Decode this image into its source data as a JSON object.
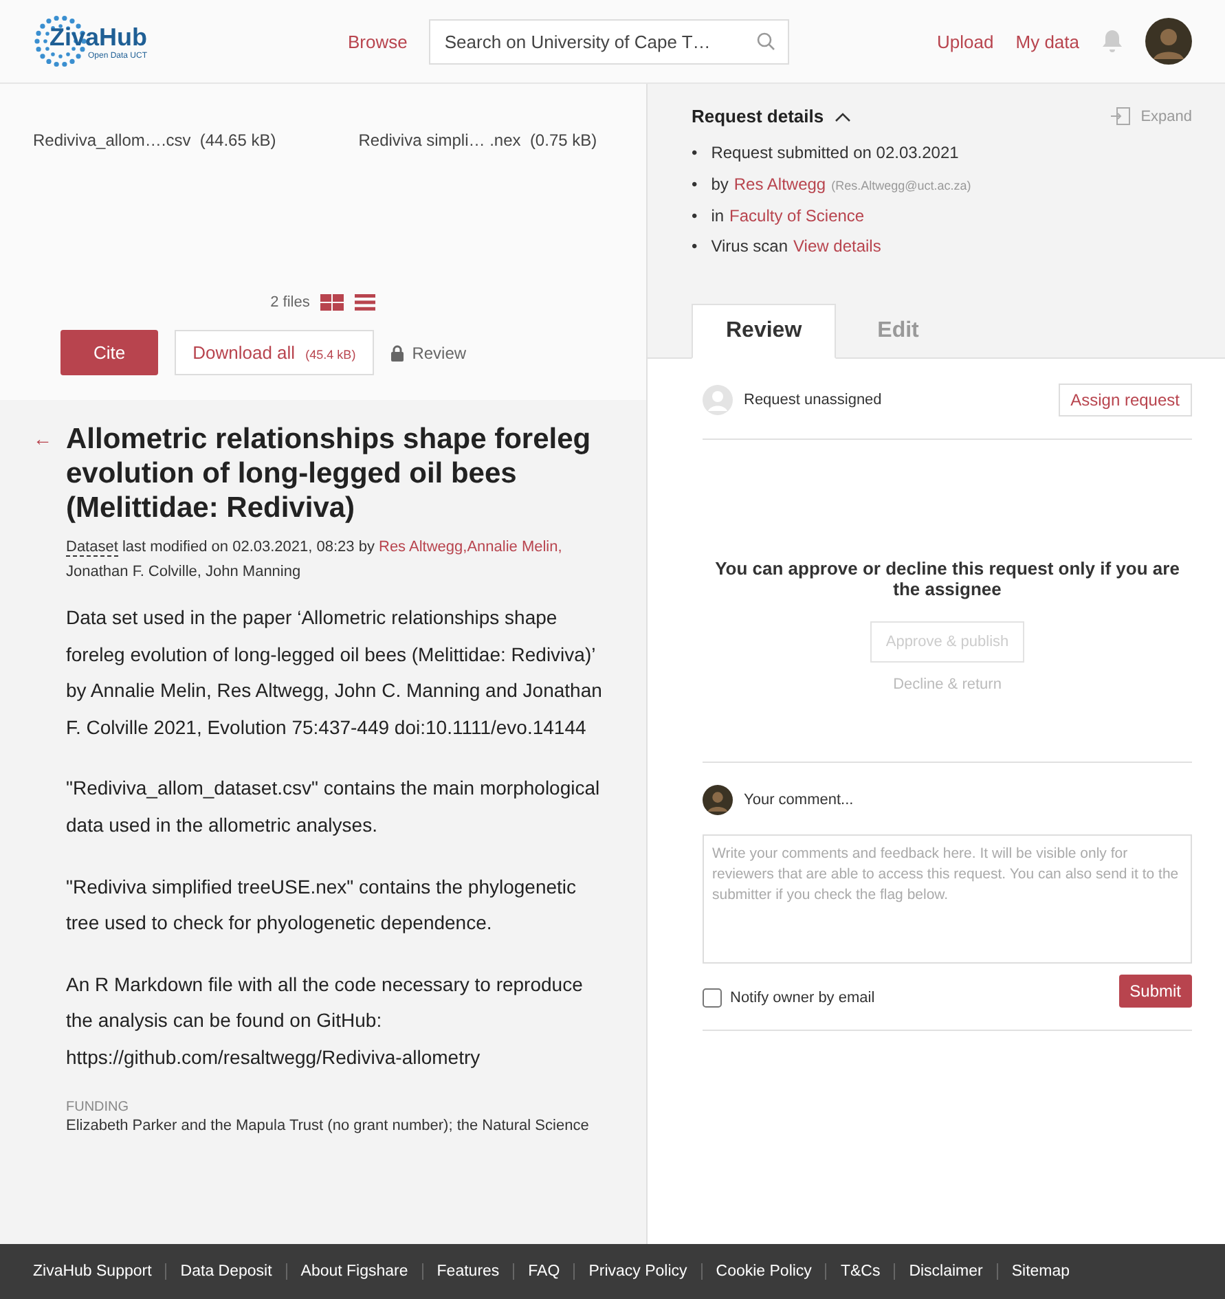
{
  "header": {
    "logo": {
      "name": "ZivaHub",
      "tagline": "Open Data UCT"
    },
    "nav": [
      {
        "label": "Browse"
      }
    ],
    "search": {
      "placeholder": "Search on University of Cape T…"
    },
    "actions": [
      {
        "label": "Upload"
      },
      {
        "label": "My data"
      }
    ]
  },
  "files": {
    "items": [
      {
        "name": "Rediviva_allom….csv",
        "size": "(44.65 kB)"
      },
      {
        "name": "Rediviva simpli… .nex",
        "size": "(0.75 kB)"
      }
    ],
    "count": "2 files",
    "cite": "Cite",
    "download": {
      "label": "Download all",
      "size": "(45.4 kB)"
    },
    "review": "Review"
  },
  "item": {
    "back": "←",
    "title": "Allometric relationships shape foreleg evolution of long-legged oil bees (Melittidae: Rediviva)",
    "type": "Dataset",
    "modified": "last modified on 02.03.2021, 08:23 by",
    "authors_linked": [
      "Res Altwegg,",
      "Annalie Melin,"
    ],
    "authors_plain": "Jonathan F. Colville, John Manning",
    "description": [
      "Data set used in the paper ‘Allometric relationships shape foreleg evolution of long-legged oil bees (Melittidae: Rediviva)’ by Annalie Melin, Res Altwegg, John C. Manning and Jonathan F. Colville 2021, Evolution 75:437-449 doi:10.1111/evo.14144",
      "\"Rediviva_allom_dataset.csv\" contains the main morphological data used in the allometric analyses.",
      "\"Rediviva simplified treeUSE.nex\" contains the phylogenetic tree used to check for phyologenetic dependence.",
      "An R Markdown file with all the code necessary to reproduce the analysis can be found on GitHub: https://github.com/resaltwegg/Rediviva-allometry"
    ],
    "funding_label": "FUNDING",
    "funding": "Elizabeth Parker and the Mapula Trust (no grant number); the Natural Science"
  },
  "request": {
    "title": "Request details",
    "expand": "Expand",
    "details": [
      {
        "bullet": "•",
        "text": "Request submitted on 02.03.2021"
      },
      {
        "bullet": "•",
        "prefix": "by",
        "link": "Res Altwegg",
        "note": "(Res.Altwegg@uct.ac.za)"
      },
      {
        "bullet": "•",
        "prefix": "in",
        "link": "Faculty of Science"
      },
      {
        "bullet": "•",
        "prefix": "Virus scan",
        "link": "View details"
      }
    ]
  },
  "tabs": [
    {
      "label": "Review",
      "selected": true
    },
    {
      "label": "Edit",
      "selected": false
    }
  ],
  "review": {
    "assignee": "Request unassigned",
    "assign": "Assign request",
    "notice": "You can approve or decline this request only if you are the assignee",
    "approve": {
      "label": "Approve & publish",
      "disabled": true
    },
    "decline": "Decline & return",
    "comment_label": "Your comment...",
    "comment_placeholder": "Write your comments and feedback here. It will be visible only for reviewers that are able to access this request. You can also send it to the submitter if you check the flag below.",
    "notify": {
      "label": "Notify owner by email",
      "checked": false
    },
    "submit": "Submit"
  },
  "footer": [
    {
      "label": "ZivaHub Support"
    },
    {
      "label": "Data Deposit"
    },
    {
      "label": "About Figshare"
    },
    {
      "label": "Features"
    },
    {
      "label": "FAQ"
    },
    {
      "label": "Privacy Policy"
    },
    {
      "label": "Cookie Policy"
    },
    {
      "label": "T&Cs"
    },
    {
      "label": "Disclaimer"
    },
    {
      "label": "Sitemap"
    }
  ]
}
